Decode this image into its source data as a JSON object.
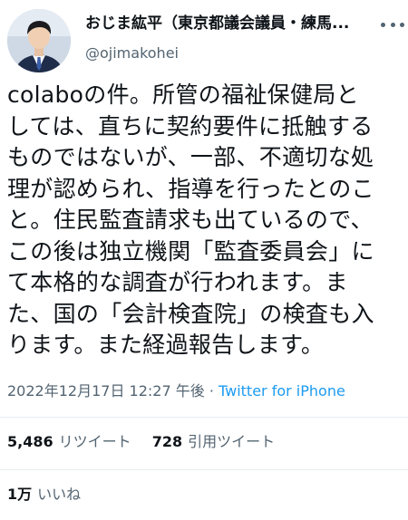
{
  "author": {
    "display_name": "おじま紘平（東京都議会議員・練馬...",
    "handle": "@ojimakohei",
    "avatar_icon": "profile-photo"
  },
  "tweet": {
    "lines": [
      "colaboの件。所管の福祉保健局と",
      "しては、直ちに契約要件に抵触する",
      "ものではないが、一部、不適切な処",
      "理が認められ、指導を行ったとのこ",
      "と。住民監査請求も出ているので、",
      "この後は独立機関「監査委員会」に",
      "て本格的な調査が行われます。ま",
      "た、国の「会計検査院」の検査も入",
      "ります。また経過報告します。"
    ]
  },
  "meta": {
    "timestamp": "2022年12月17日 12:27 午後",
    "separator": " · ",
    "source": "Twitter for iPhone"
  },
  "stats": {
    "retweets_count": "5,486",
    "retweets_label": "リツイート",
    "quotes_count": "728",
    "quotes_label": "引用ツイート",
    "likes_count": "1万",
    "likes_label": "いいね"
  },
  "colors": {
    "text": "#0f1419",
    "secondary": "#536471",
    "link": "#1d9bf0",
    "divider": "#e6ecf0"
  },
  "icons": {
    "more": "more-horizontal-icon"
  }
}
